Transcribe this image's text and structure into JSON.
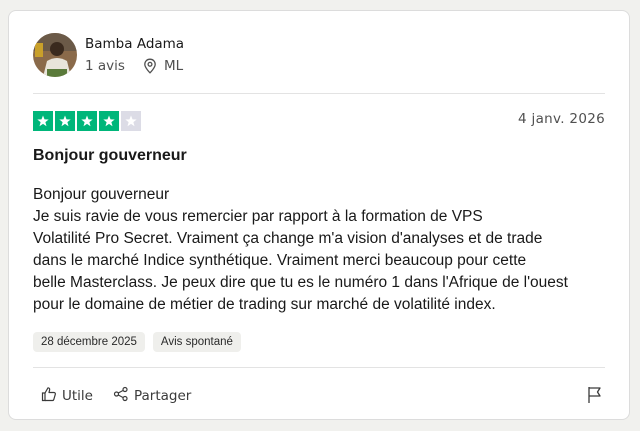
{
  "review": {
    "author": {
      "name": "Bamba Adama",
      "reviews_count": "1 avis",
      "location": "ML"
    },
    "rating": 4,
    "rating_max": 5,
    "date": "4 janv. 2026",
    "title": "Bonjour gouverneur",
    "body_lines": [
      "Bonjour gouverneur",
      "Je suis ravie de vous remercier par rapport à la formation de VPS",
      "Volatilité Pro Secret. Vraiment ça change m'a vision d'analyses et de trade",
      "dans le marché Indice synthétique. Vraiment merci beaucoup pour cette",
      "belle Masterclass. Je peux dire que tu es le numéro 1 dans l'Afrique de l'ouest",
      "pour le domaine de métier de trading sur marché de volatilité index."
    ],
    "tags": [
      "28 décembre 2025",
      "Avis spontané"
    ],
    "actions": {
      "useful_label": "Utile",
      "share_label": "Partager"
    }
  },
  "colors": {
    "star_filled": "#00b67a",
    "star_empty": "#dcdce6",
    "divider": "#e3e3e3",
    "tag_bg": "#efefec"
  },
  "icons": {
    "location": "map-pin-icon",
    "star": "star-icon",
    "useful": "thumbs-up-icon",
    "share": "share-icon",
    "report": "flag-icon"
  }
}
